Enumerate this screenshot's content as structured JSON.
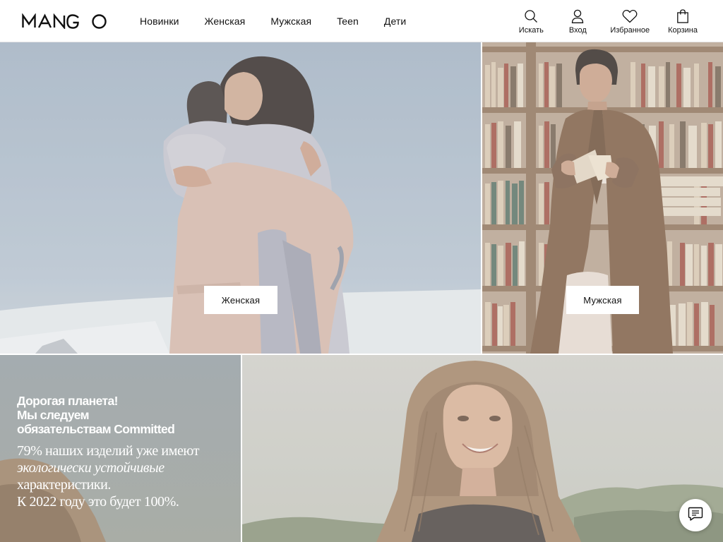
{
  "brand": {
    "logo_text": "MANGO"
  },
  "nav": {
    "items": [
      {
        "label": "Новинки"
      },
      {
        "label": "Женская"
      },
      {
        "label": "Мужская"
      },
      {
        "label": "Teen"
      },
      {
        "label": "Дети"
      }
    ]
  },
  "tools": {
    "search_label": "Искать",
    "login_label": "Вход",
    "favorites_label": "Избранное",
    "cart_label": "Корзина"
  },
  "tiles": {
    "women_button": "Женская",
    "men_button": "Мужская"
  },
  "promo": {
    "heading_lines": [
      "Дорогая планета!",
      "Мы следуем",
      "обязательствам Committed"
    ],
    "body_1": "79% наших изделий уже имеют ",
    "body_em": "экологически устойчивые",
    "body_2": " характеристики.",
    "body_3": "К 2022 году это будет 100%."
  },
  "icons": {
    "search": "search-icon",
    "login": "user-icon",
    "favorites": "heart-icon",
    "cart": "shopping-bag-icon",
    "chat": "chat-icon"
  },
  "colors": {
    "header_bg": "#ffffff",
    "text": "#111111",
    "sky": "#a7b6c6",
    "promo_bg": "#9aa3a8"
  }
}
